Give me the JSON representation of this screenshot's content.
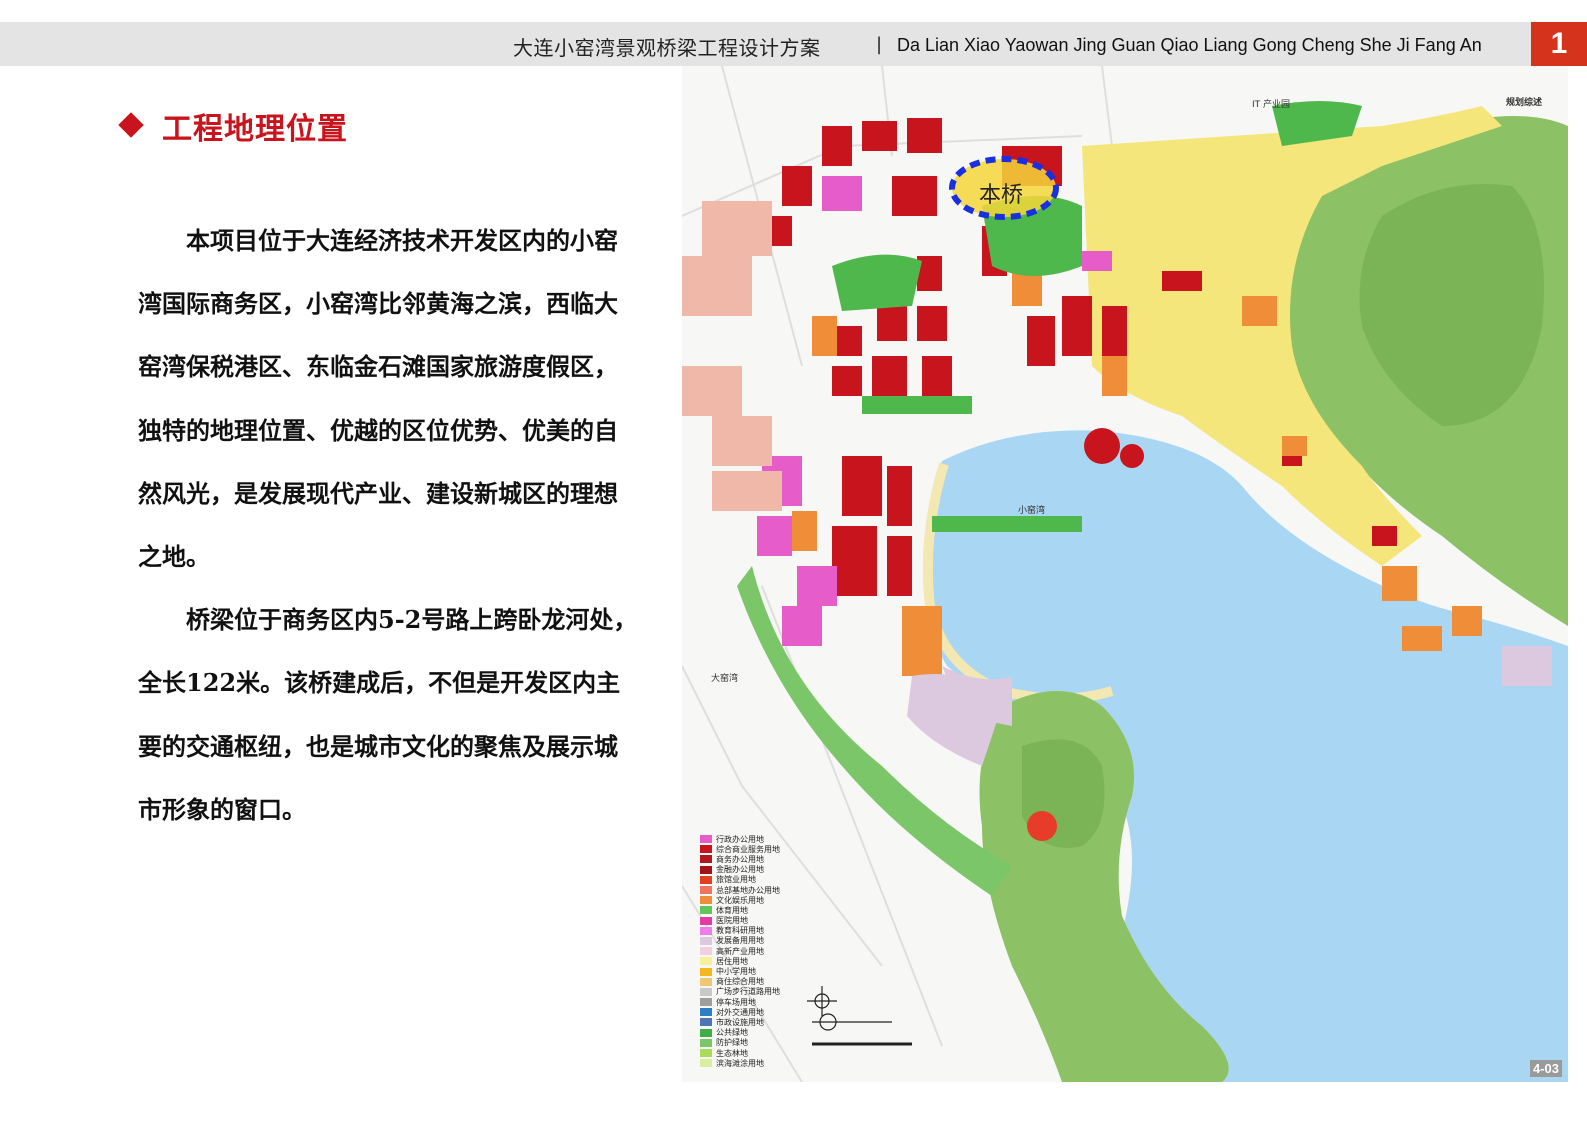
{
  "header": {
    "title_cn": "大连小窑湾景观桥梁工程设计方案",
    "separator": "|",
    "title_en": "Da Lian Xiao Yaowan Jing Guan Qiao Liang Gong Cheng She Ji Fang An",
    "page_number": "1"
  },
  "section": {
    "title": "工程地理位置"
  },
  "body": {
    "p1": "本项目位于大连经济技术开发区内的小窑湾国际商务区，小窑湾比邻黄海之滨，西临大窑湾保税港区、东临金石滩国家旅游度假区，独特的地理位置、优越的区位优势、优美的自然风光，是发展现代产业、建设新城区的理想之地。",
    "p2": "桥梁位于商务区内5-2号路上跨卧龙河处，全长122米。该桥建成后，不但是开发区内主要的交通枢纽，也是城市文化的聚焦及展示城市形象的窗口。"
  },
  "map": {
    "bridge_label": "本桥",
    "bay_label": "小窑湾",
    "west_bay_label": "大窑湾",
    "it_park_label": "IT 产业园",
    "plan_label": "规划综述",
    "code": "4-03",
    "colors": {
      "water": "#a9d6f2",
      "mountain": "#8cc265",
      "green": "#4fb84d",
      "residential": "#f4e67a",
      "commercial": "#c8141c",
      "office": "#e73c2a",
      "culture": "#ef8d38",
      "admin": "#e65cc9",
      "development": "#dcc8df",
      "highlight": "#1a2fe0"
    }
  },
  "legend": [
    {
      "label": "行政办公用地",
      "color": "#e65cc9"
    },
    {
      "label": "综合商业服务用地",
      "color": "#c8141c"
    },
    {
      "label": "商务办公用地",
      "color": "#b01820"
    },
    {
      "label": "金融办公用地",
      "color": "#a51218"
    },
    {
      "label": "旅馆业用地",
      "color": "#e2401e"
    },
    {
      "label": "总部基地办公用地",
      "color": "#f0745f"
    },
    {
      "label": "文化娱乐用地",
      "color": "#ef8d38"
    },
    {
      "label": "体育用地",
      "color": "#5fc65a"
    },
    {
      "label": "医院用地",
      "color": "#e33aa6"
    },
    {
      "label": "教育科研用地",
      "color": "#f07ce8"
    },
    {
      "label": "发展备用用地",
      "color": "#dcc8df"
    },
    {
      "label": "高新产业用地",
      "color": "#f2d0e0"
    },
    {
      "label": "居住用地",
      "color": "#f7ef9a"
    },
    {
      "label": "中小学用地",
      "color": "#f4b81c"
    },
    {
      "label": "商住综合用地",
      "color": "#f1c773"
    },
    {
      "label": "广场步行道路用地",
      "color": "#c9c9c9"
    },
    {
      "label": "停车场用地",
      "color": "#9e9e9e"
    },
    {
      "label": "对外交通用地",
      "color": "#2d7fc1"
    },
    {
      "label": "市政设施用地",
      "color": "#4f74b8"
    },
    {
      "label": "公共绿地",
      "color": "#3fae49"
    },
    {
      "label": "防护绿地",
      "color": "#7cc66a"
    },
    {
      "label": "生态林地",
      "color": "#aadb5a"
    },
    {
      "label": "滨海滩涂用地",
      "color": "#d9efa0"
    }
  ]
}
